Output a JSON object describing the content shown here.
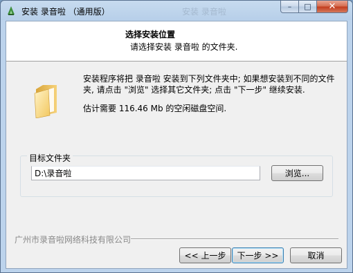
{
  "window": {
    "title": "安装 录音啦 （通用版）",
    "ghost_title": "安装 录音啦",
    "controls": {
      "minimize": "–",
      "maximize": "□",
      "close": "✕"
    }
  },
  "header": {
    "title": "选择安装位置",
    "subtitle": "请选择安装 录音啦 的文件夹."
  },
  "body": {
    "intro": "安装程序将把 录音啦 安装到下列文件夹中; 如果想安装到不同的文件夹, 请点击 \"浏览\" 选择其它文件夹; 点击 \"下一步\" 继续安装.",
    "space_required": "估计需要 116.46 Mb 的空闲磁盘空间."
  },
  "destination": {
    "label": "目标文件夹",
    "path": "D:\\录音啦",
    "browse_label": "浏览..."
  },
  "footer": {
    "brand": "广州市录音啦网络科技有限公司",
    "back_label": "<< 上一步",
    "next_label": "下一步 >>",
    "cancel_label": "取消"
  }
}
